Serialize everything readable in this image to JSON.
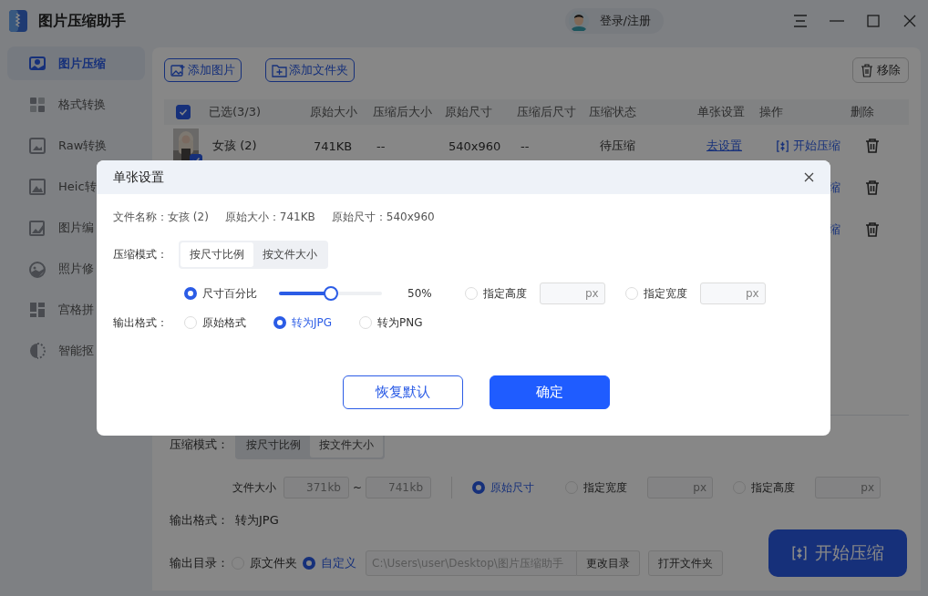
{
  "window": {
    "title": "图片压缩助手"
  },
  "account": {
    "label": "登录/注册"
  },
  "sidebar": {
    "items": [
      {
        "label": "图片压缩",
        "selected": true
      },
      {
        "label": "格式转换",
        "selected": false
      },
      {
        "label": "Raw转换",
        "selected": false
      },
      {
        "label": "Heic转",
        "selected": false
      },
      {
        "label": "图片编",
        "selected": false
      },
      {
        "label": "照片修",
        "selected": false
      },
      {
        "label": "宫格拼",
        "selected": false
      },
      {
        "label": "智能抠",
        "selected": false
      }
    ]
  },
  "toolbar": {
    "buttons": [
      "添加图片",
      "添加文件夹"
    ],
    "remove": "移除"
  },
  "table": {
    "select_all_checked": true,
    "columns": [
      "已选(3/3)",
      "原始大小",
      "压缩后大小",
      "原始尺寸",
      "压缩后尺寸",
      "压缩状态",
      "单张设置",
      "操作",
      "删除"
    ],
    "rows": [
      {
        "kind": "full",
        "checked": true,
        "name": "女孩 (2)",
        "original_size": "741KB",
        "compressed_size": "--",
        "original_dimensions": "540x960",
        "compressed_dimensions": "--",
        "status": "待压缩",
        "settings_link": "去设置",
        "action": "开始压缩"
      },
      {
        "kind": "covered",
        "action": "缩"
      },
      {
        "kind": "covered",
        "action": "缩"
      }
    ]
  },
  "settings": {
    "mode_label": "压缩模式：",
    "modes": [
      {
        "label": "按尺寸比例",
        "selected": false
      },
      {
        "label": "按文件大小",
        "selected": true
      }
    ],
    "size_label": "文件大小",
    "size_min": "371",
    "size_min_unit": "kb",
    "range_separator": "~",
    "size_max": "741",
    "size_max_unit": "kb",
    "dimension_options": [
      {
        "kind": "plain",
        "label": "原始尺寸",
        "selected": true
      },
      {
        "kind": "input",
        "label": "指定宽度",
        "selected": false,
        "unit": "px"
      },
      {
        "kind": "input",
        "label": "指定高度",
        "selected": false,
        "unit": "px"
      }
    ],
    "format_label": "输出格式：",
    "format_value": "转为JPG",
    "output_label": "输出目录：",
    "output_options": [
      {
        "label": "原文件夹",
        "selected": false
      },
      {
        "label": "自定义",
        "selected": true
      }
    ],
    "path": "C:\\Users\\user\\Desktop\\图片压缩助手",
    "change_dir": "更改目录",
    "open_folder": "打开文件夹"
  },
  "start_button": "开始压缩",
  "dialog": {
    "title": "单张设置",
    "info": [
      "文件名称：女孩 (2)",
      "原始大小：741KB",
      "原始尺寸：540x960"
    ],
    "mode_label": "压缩模式：",
    "modes": [
      {
        "label": "按尺寸比例",
        "selected": true
      },
      {
        "label": "按文件大小",
        "selected": false
      }
    ],
    "size_options": [
      {
        "kind": "slider",
        "label": "尺寸百分比",
        "selected": true,
        "level": 0.5,
        "reading": "50%"
      },
      {
        "kind": "input",
        "label": "指定高度",
        "selected": false,
        "unit": "px"
      },
      {
        "kind": "input",
        "label": "指定宽度",
        "selected": false,
        "unit": "px"
      }
    ],
    "format_label": "输出格式：",
    "formats": [
      {
        "label": "原始格式",
        "selected": false
      },
      {
        "label": "转为JPG",
        "selected": true
      },
      {
        "label": "转为PNG",
        "selected": false
      }
    ],
    "buttons": [
      {
        "kind": "secondary",
        "label": "恢复默认"
      },
      {
        "kind": "primary",
        "label": "确定"
      }
    ]
  }
}
